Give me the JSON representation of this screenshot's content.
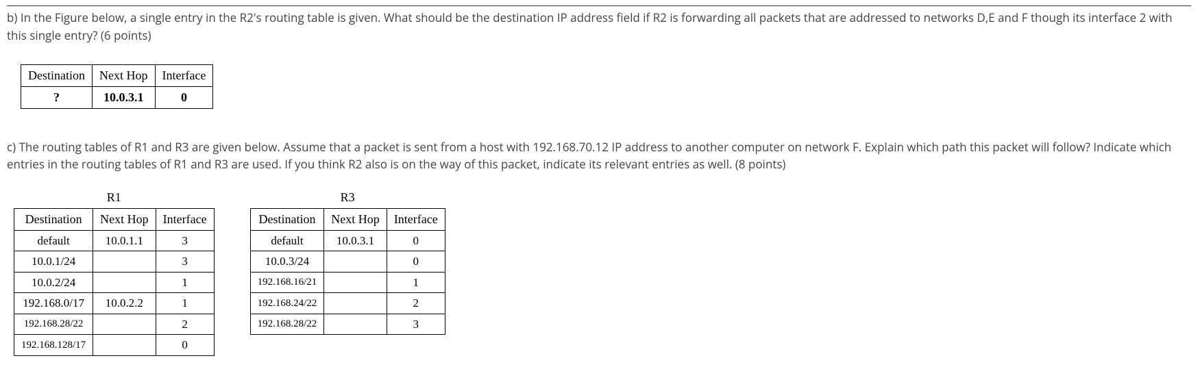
{
  "question_b": "b) In the Figure below, a single entry in the R2's routing table is given. What should be the destination IP address field if R2 is forwarding all packets that are addressed to networks D,E and F though its interface 2 with this single entry? (6 points)",
  "question_c": "c) The routing tables of R1 and R3 are given below. Assume that a packet is sent from a host with 192.168.70.12 IP address to another computer on network F. Explain which path this packet will follow? Indicate which entries in the routing tables of R1 and R3 are used. If you think R2 also is on the way of this packet, indicate its relevant entries as well. (8 points)",
  "small_table": {
    "headers": {
      "dest": "Destination",
      "nexthop": "Next Hop",
      "iface": "Interface"
    },
    "row": {
      "dest": "?",
      "nexthop": "10.0.3.1",
      "iface": "0"
    }
  },
  "r1": {
    "caption": "R1",
    "headers": {
      "dest": "Destination",
      "nexthop": "Next Hop",
      "iface": "Interface"
    },
    "rows": [
      {
        "dest": "default",
        "nexthop": "10.0.1.1",
        "iface": "3"
      },
      {
        "dest": "10.0.1/24",
        "nexthop": "",
        "iface": "3"
      },
      {
        "dest": "10.0.2/24",
        "nexthop": "",
        "iface": "1"
      },
      {
        "dest": "192.168.0/17",
        "nexthop": "10.0.2.2",
        "iface": "1"
      },
      {
        "dest": "192.168.28/22",
        "nexthop": "",
        "iface": "2"
      },
      {
        "dest": "192.168.128/17",
        "nexthop": "",
        "iface": "0"
      }
    ]
  },
  "r3": {
    "caption": "R3",
    "headers": {
      "dest": "Destination",
      "nexthop": "Next Hop",
      "iface": "Interface"
    },
    "rows": [
      {
        "dest": "default",
        "nexthop": "10.0.3.1",
        "iface": "0"
      },
      {
        "dest": "10.0.3/24",
        "nexthop": "",
        "iface": "0"
      },
      {
        "dest": "192.168.16/21",
        "nexthop": "",
        "iface": "1"
      },
      {
        "dest": "192.168.24/22",
        "nexthop": "",
        "iface": "2"
      },
      {
        "dest": "192.168.28/22",
        "nexthop": "",
        "iface": "3"
      }
    ]
  }
}
